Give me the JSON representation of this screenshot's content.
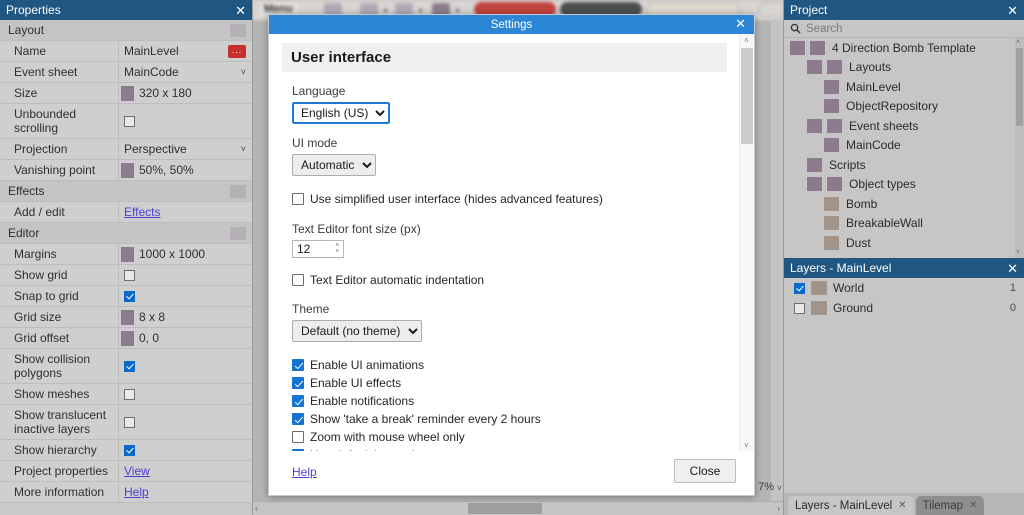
{
  "properties_panel": {
    "title": "Properties",
    "close_icon": "close-icon",
    "rows": [
      {
        "label": "Layout",
        "kind": "group"
      },
      {
        "label": "Name",
        "value": "MainLevel",
        "kind": "text-with-button",
        "button": "..."
      },
      {
        "label": "Event sheet",
        "value": "MainCode",
        "kind": "dropdown"
      },
      {
        "label": "Size",
        "value": "320 x 180",
        "kind": "swatch-text"
      },
      {
        "label": "Unbounded scrolling",
        "value": "",
        "kind": "checkbox",
        "checked": false
      },
      {
        "label": "Projection",
        "value": "Perspective",
        "kind": "dropdown"
      },
      {
        "label": "Vanishing point",
        "value": "50%, 50%",
        "kind": "swatch-text"
      },
      {
        "label": "Effects",
        "kind": "group"
      },
      {
        "label": "Add / edit",
        "value": "Effects",
        "kind": "link"
      },
      {
        "label": "Editor",
        "kind": "group"
      },
      {
        "label": "Margins",
        "value": "1000 x 1000",
        "kind": "swatch-text"
      },
      {
        "label": "Show grid",
        "value": "",
        "kind": "checkbox",
        "checked": false
      },
      {
        "label": "Snap to grid",
        "value": "",
        "kind": "checkbox",
        "checked": true
      },
      {
        "label": "Grid size",
        "value": "8 x 8",
        "kind": "swatch-text"
      },
      {
        "label": "Grid offset",
        "value": "0, 0",
        "kind": "swatch-text"
      },
      {
        "label": "Show collision polygons",
        "value": "",
        "kind": "checkbox",
        "checked": true
      },
      {
        "label": "Show meshes",
        "value": "",
        "kind": "checkbox",
        "checked": false
      },
      {
        "label": "Show translucent inactive layers",
        "value": "",
        "kind": "checkbox",
        "checked": false
      },
      {
        "label": "Show hierarchy",
        "value": "",
        "kind": "checkbox",
        "checked": true
      },
      {
        "label": "Project properties",
        "value": "View",
        "kind": "link"
      },
      {
        "label": "More information",
        "value": "Help",
        "kind": "link"
      }
    ]
  },
  "toolbar": {
    "menu_label": "Menu"
  },
  "canvas": {
    "zoom_readout": "7%",
    "hscroll_left_arrow": "‹",
    "hscroll_right_arrow": "›"
  },
  "project_panel": {
    "title": "Project",
    "close_icon": "close-icon",
    "search": {
      "icon": "search-icon",
      "placeholder": "Search",
      "value": ""
    },
    "tree": [
      {
        "label": "4 Direction Bomb Template",
        "depth": 0,
        "icons": 2,
        "icon_kind": "folder"
      },
      {
        "label": "Layouts",
        "depth": 1,
        "icons": 2,
        "icon_kind": "folder"
      },
      {
        "label": "MainLevel",
        "depth": 2,
        "icons": 1,
        "icon_kind": "folder"
      },
      {
        "label": "ObjectRepository",
        "depth": 2,
        "icons": 1,
        "icon_kind": "folder"
      },
      {
        "label": "Event sheets",
        "depth": 1,
        "icons": 2,
        "icon_kind": "folder"
      },
      {
        "label": "MainCode",
        "depth": 2,
        "icons": 1,
        "icon_kind": "folder"
      },
      {
        "label": "Scripts",
        "depth": 1,
        "icons": 1,
        "icon_kind": "folder"
      },
      {
        "label": "Object types",
        "depth": 1,
        "icons": 2,
        "icon_kind": "folder"
      },
      {
        "label": "Bomb",
        "depth": 2,
        "icons": 1,
        "icon_kind": "object"
      },
      {
        "label": "BreakableWall",
        "depth": 2,
        "icons": 1,
        "icon_kind": "object"
      },
      {
        "label": "Dust",
        "depth": 2,
        "icons": 1,
        "icon_kind": "object"
      }
    ]
  },
  "layers_panel": {
    "title": "Layers - MainLevel",
    "close_icon": "close-icon",
    "layers": [
      {
        "name": "World",
        "index": "1",
        "visible": true
      },
      {
        "name": "Ground",
        "index": "0",
        "visible": false
      }
    ],
    "tabs": [
      {
        "label": "Layers - MainLevel",
        "active": true,
        "close_icon": "close-icon"
      },
      {
        "label": "Tilemap",
        "active": false,
        "close_icon": "close-icon"
      }
    ]
  },
  "settings_dialog": {
    "title": "Settings",
    "close_icon": "close-icon",
    "section_title": "User interface",
    "language": {
      "label": "Language",
      "value": "English (US)",
      "focused": true
    },
    "ui_mode": {
      "label": "UI mode",
      "value": "Automatic"
    },
    "simplified_ui": {
      "label": "Use simplified user interface (hides advanced features)",
      "checked": false
    },
    "font_size": {
      "label": "Text Editor font size (px)",
      "value": "12"
    },
    "auto_indent": {
      "label": "Text Editor automatic indentation",
      "checked": false
    },
    "theme": {
      "label": "Theme",
      "value": "Default (no theme)"
    },
    "toggles": [
      {
        "label": "Enable UI animations",
        "checked": true
      },
      {
        "label": "Enable UI effects",
        "checked": true
      },
      {
        "label": "Enable notifications",
        "checked": true
      },
      {
        "label": "Show 'take a break' reminder every 2 hours",
        "checked": true
      },
      {
        "label": "Zoom with mouse wheel only",
        "checked": false
      },
      {
        "label": "Use default icon color",
        "checked": true
      }
    ],
    "help_link": "Help",
    "close_button": "Close",
    "scrollbar_up_icon": "chevron-up-icon",
    "scrollbar_down_icon": "chevron-down-icon"
  },
  "colors": {
    "panel_title_bg": "#1f5782",
    "dialog_title_bg": "#2b87d6",
    "checkbox_accent": "#1573d3",
    "link": "#4a3fd0",
    "folder_icon": "#8d7b8d",
    "object_icon": "#a3948a",
    "danger_button": "#c9302c"
  }
}
